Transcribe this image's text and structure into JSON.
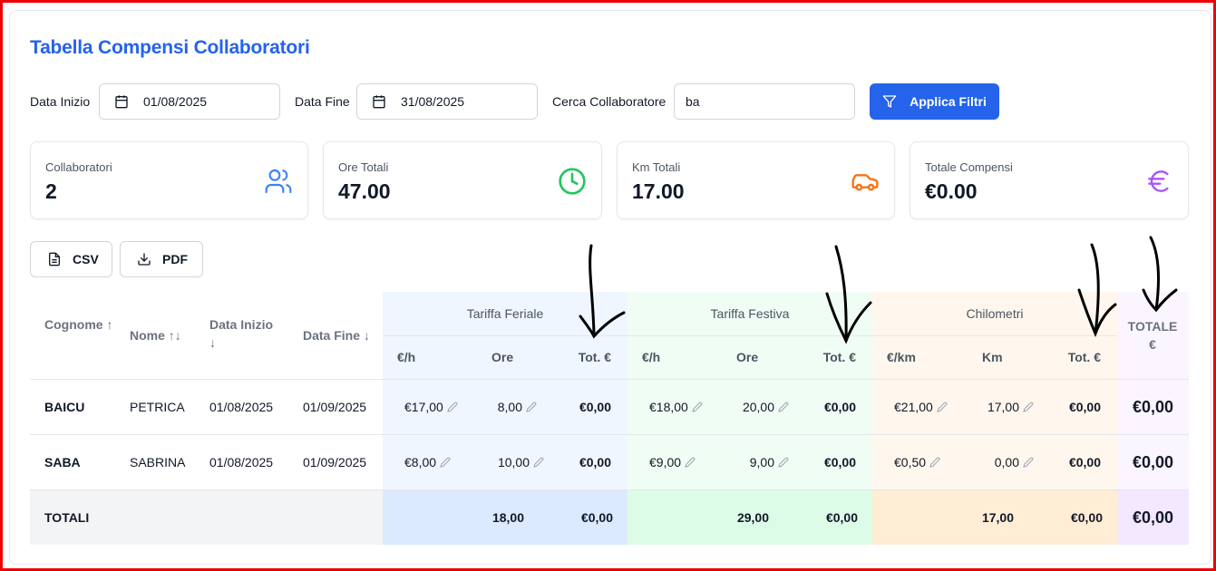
{
  "page": {
    "title": "Tabella Compensi Collaboratori"
  },
  "filters": {
    "start_label": "Data Inizio",
    "start_value": "01/08/2025",
    "end_label": "Data Fine",
    "end_value": "31/08/2025",
    "search_label": "Cerca Collaboratore",
    "search_value": "ba",
    "apply_label": "Applica Filtri"
  },
  "stats": [
    {
      "label": "Collaboratori",
      "value": "2",
      "icon": "users-icon",
      "color": "#3b82f6"
    },
    {
      "label": "Ore Totali",
      "value": "47.00",
      "icon": "clock-icon",
      "color": "#22c55e"
    },
    {
      "label": "Km Totali",
      "value": "17.00",
      "icon": "car-icon",
      "color": "#f97316"
    },
    {
      "label": "Totale Compensi",
      "value": "€0.00",
      "icon": "euro-icon",
      "color": "#a855f7"
    }
  ],
  "export": {
    "csv_label": "CSV",
    "pdf_label": "PDF"
  },
  "table": {
    "headers": {
      "cognome": "Cognome ↑",
      "nome": "Nome ↑↓",
      "data_inizio": "Data Inizio ↓",
      "data_fine": "Data Fine ↓",
      "group_feriale": "Tariffa Feriale",
      "group_festiva": "Tariffa Festiva",
      "group_km": "Chilometri",
      "totale": "TOTALE €",
      "eur_h": "€/h",
      "ore": "Ore",
      "tot": "Tot. €",
      "eur_km": "€/km",
      "km": "Km"
    },
    "rows": [
      {
        "cognome": "BAICU",
        "nome": "PETRICA",
        "data_inizio": "01/08/2025",
        "data_fine": "01/09/2025",
        "fer_rate": "€17,00",
        "fer_ore": "8,00",
        "fer_tot": "€0,00",
        "fes_rate": "€18,00",
        "fes_ore": "20,00",
        "fes_tot": "€0,00",
        "km_rate": "€21,00",
        "km_km": "17,00",
        "km_tot": "€0,00",
        "totale": "€0,00"
      },
      {
        "cognome": "SABA",
        "nome": "SABRINA",
        "data_inizio": "01/08/2025",
        "data_fine": "01/09/2025",
        "fer_rate": "€8,00",
        "fer_ore": "10,00",
        "fer_tot": "€0,00",
        "fes_rate": "€9,00",
        "fes_ore": "9,00",
        "fes_tot": "€0,00",
        "km_rate": "€0,50",
        "km_km": "0,00",
        "km_tot": "€0,00",
        "totale": "€0,00"
      }
    ],
    "totals": {
      "label": "TOTALI",
      "fer_ore": "18,00",
      "fer_tot": "€0,00",
      "fes_ore": "29,00",
      "fes_tot": "€0,00",
      "km_km": "17,00",
      "km_tot": "€0,00",
      "totale": "€0,00"
    }
  },
  "colors": {
    "accent": "#2563eb",
    "feriale_bg": "#eff6ff",
    "festiva_bg": "#f0fdf4",
    "km_bg": "#fff7ed",
    "totale_bg": "#faf5ff"
  }
}
